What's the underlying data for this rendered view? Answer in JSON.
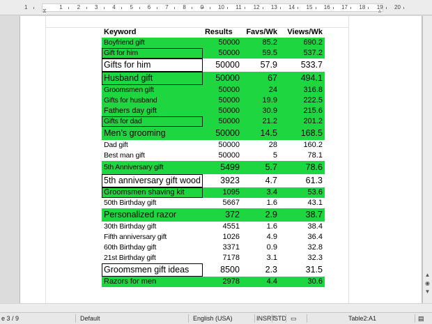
{
  "ruler": {
    "labels": [
      "1",
      "1",
      "2",
      "3",
      "4",
      "5",
      "6",
      "7",
      "8",
      "9",
      "10",
      "11",
      "12",
      "13",
      "14",
      "15",
      "16",
      "17",
      "18",
      "19",
      "20"
    ]
  },
  "table": {
    "headers": [
      "Keyword",
      "Results",
      "Favs/Wk",
      "Views/Wk"
    ],
    "rows": [
      {
        "keyword": "Boyfriend gift",
        "results": "50000",
        "favs": "85.2",
        "views": "690.2",
        "style": "green narrow"
      },
      {
        "keyword": "Gift for him",
        "results": "50000",
        "favs": "59.5",
        "views": "537.2",
        "style": "green boxed narrow"
      },
      {
        "keyword": "Gifts for him",
        "results": "50000",
        "favs": "57.9",
        "views": "533.7",
        "style": "big boxed"
      },
      {
        "keyword": "Husband gift",
        "results": "50000",
        "favs": "67",
        "views": "494.1",
        "style": "green big boxed"
      },
      {
        "keyword": "Groomsmen gift",
        "results": "50000",
        "favs": "24",
        "views": "316.8",
        "style": "green narrow"
      },
      {
        "keyword": "Gifts for husband",
        "results": "50000",
        "favs": "19.9",
        "views": "222.5",
        "style": "green narrow"
      },
      {
        "keyword": "Fathers day gift",
        "results": "50000",
        "favs": "30.9",
        "views": "215.6",
        "style": "green"
      },
      {
        "keyword": "Gifts for dad",
        "results": "50000",
        "favs": "21.2",
        "views": "201.2",
        "style": "green boxed narrow"
      },
      {
        "keyword": "Men’s grooming",
        "results": "50000",
        "favs": "14.5",
        "views": "168.5",
        "style": "green big"
      },
      {
        "keyword": "Dad gift",
        "results": "50000",
        "favs": "28",
        "views": "160.2",
        "style": "narrow"
      },
      {
        "keyword": "Best man gift",
        "results": "50000",
        "favs": "5",
        "views": "78.1",
        "style": "narrow"
      },
      {
        "keyword": "5th Anniversary gift",
        "results": "5499",
        "favs": "5.7",
        "views": "78.6",
        "style": "green big narrow"
      },
      {
        "keyword": "5th anniversary gift wood",
        "results": "3923",
        "favs": "4.7",
        "views": "61.3",
        "style": "big boxed"
      },
      {
        "keyword": "Groomsmen shaving kit",
        "results": "1095",
        "favs": "3.4",
        "views": "53.6",
        "style": "green boxed"
      },
      {
        "keyword": "50th Birthday gift",
        "results": "5667",
        "favs": "1.6",
        "views": "43.1",
        "style": "narrow"
      },
      {
        "keyword": "Personalized razor",
        "results": "372",
        "favs": "2.9",
        "views": "38.7",
        "style": "green big"
      },
      {
        "keyword": "30th Birthday gift",
        "results": "4551",
        "favs": "1.6",
        "views": "38.4",
        "style": "narrow"
      },
      {
        "keyword": "Fifth anniversary gift",
        "results": "1026",
        "favs": "4.9",
        "views": "36.4",
        "style": "narrow"
      },
      {
        "keyword": "60th Birthday gift",
        "results": "3371",
        "favs": "0.9",
        "views": "32.8",
        "style": "narrow"
      },
      {
        "keyword": "21st Birthday gift",
        "results": "7178",
        "favs": "3.1",
        "views": "32.3",
        "style": "narrow"
      },
      {
        "keyword": "Groomsmen gift ideas",
        "results": "8500",
        "favs": "2.3",
        "views": "31.5",
        "style": "big boxed"
      },
      {
        "keyword": "Razors for men",
        "results": "2978",
        "favs": "4.4",
        "views": "30.6",
        "style": "green"
      }
    ]
  },
  "status": {
    "page": "e 3 / 9",
    "page_style": "Default",
    "language": "English (USA)",
    "insert_mode": "INSRT",
    "selection_mode": "STD",
    "cell": "Table2:A1"
  },
  "colors": {
    "row_highlight": "#1ed63f"
  }
}
